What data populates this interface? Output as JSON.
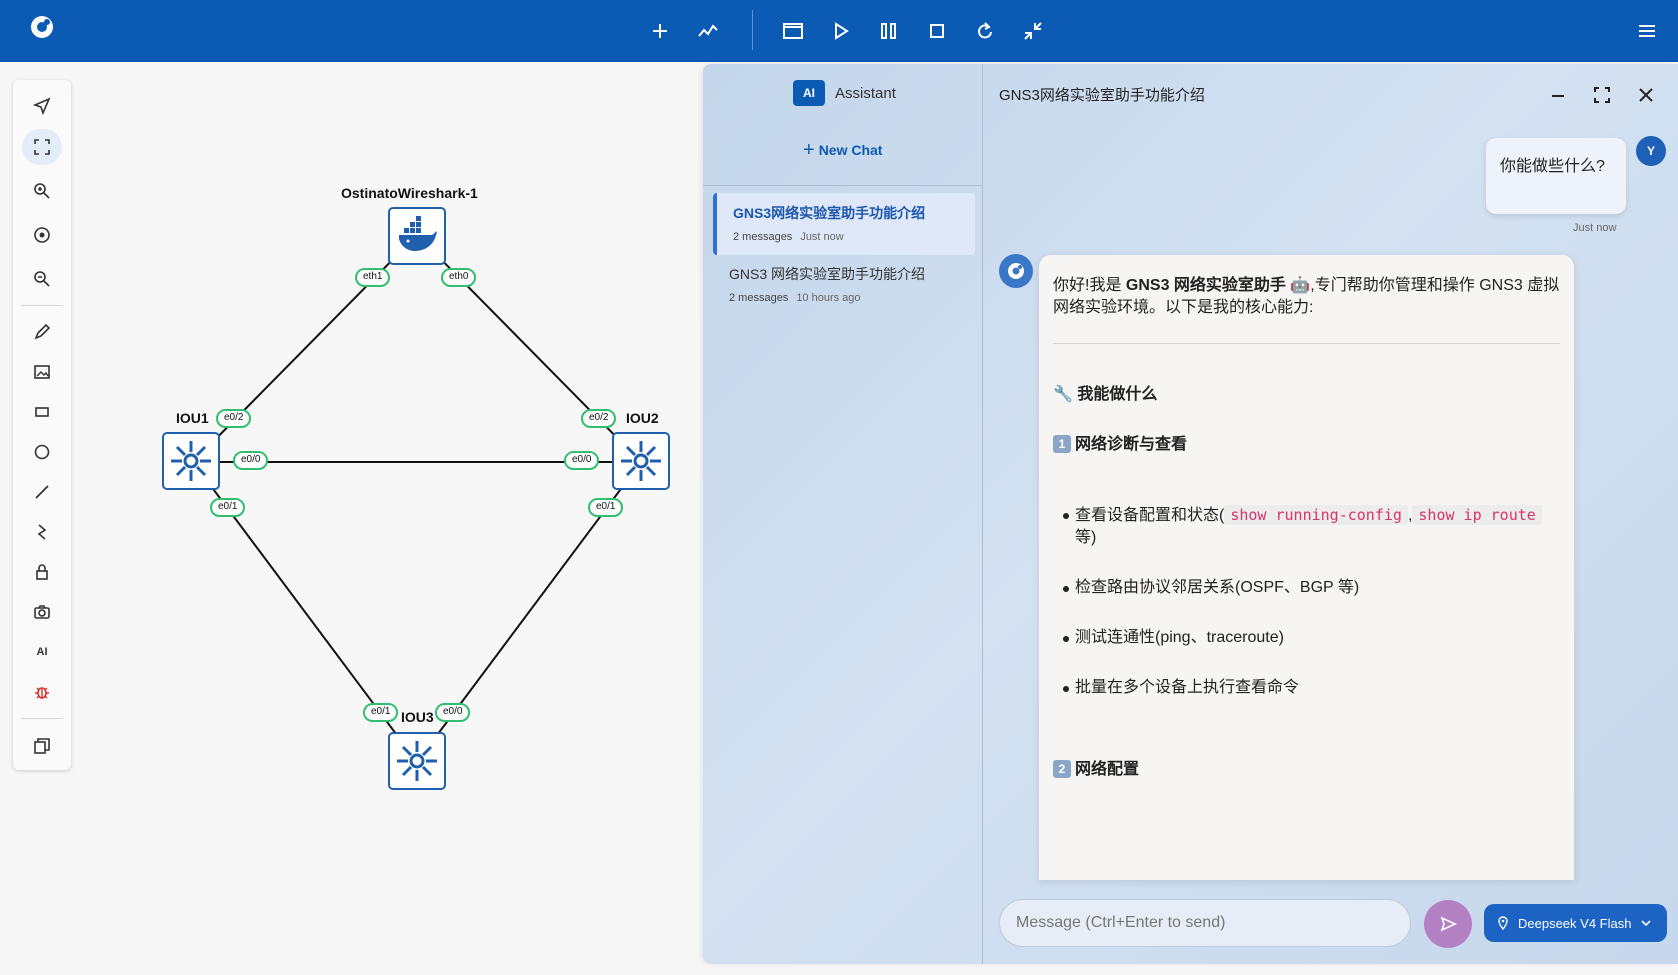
{
  "toolbar": {
    "logo_icon": "gns3-logo-icon",
    "buttons": [
      "add-icon",
      "chart-icon",
      "console-icon",
      "play-icon",
      "pause-icon",
      "stop-icon",
      "reload-icon",
      "collapse-icon",
      "menu-icon"
    ]
  },
  "tool_rail": {
    "tools": [
      "navigate-icon",
      "fit-screen-icon",
      "zoom-in-icon",
      "reset-zoom-icon",
      "zoom-out-icon",
      "pencil-icon",
      "image-icon",
      "rectangle-icon",
      "ellipse-icon",
      "line-icon",
      "curve-icon",
      "lock-icon",
      "camera-icon",
      "ai-icon",
      "bug-icon",
      "layers-icon"
    ],
    "ai_label": "AI"
  },
  "topology": {
    "nodes": {
      "wireshark": "OstinatoWireshark-1",
      "iou1": "IOU1",
      "iou2": "IOU2",
      "iou3": "IOU3"
    },
    "ports": {
      "ws_eth1": "eth1",
      "ws_eth0": "eth0",
      "iou1_e02": "e0/2",
      "iou1_e00": "e0/0",
      "iou1_e01": "e0/1",
      "iou2_e02": "e0/2",
      "iou2_e00": "e0/0",
      "iou2_e01": "e0/1",
      "iou3_e01": "e0/1",
      "iou3_e00": "e0/0"
    }
  },
  "assistant": {
    "ai_badge": "AI",
    "tab_label": "Assistant",
    "new_chat": "New Chat",
    "chats": [
      {
        "title": "GNS3网络实验室助手功能介绍",
        "count": "2 messages",
        "ago": "Just now"
      },
      {
        "title": "GNS3 网络实验室助手功能介绍",
        "count": "2 messages",
        "ago": "10 hours ago"
      }
    ],
    "conversation_title": "GNS3网络实验室助手功能介绍",
    "user_avatar": "Y",
    "user_message": "你能做些什么?",
    "user_time": "Just now",
    "bot": {
      "intro_1": "你好!我是 ",
      "intro_bold": "GNS3 网络实验室助手",
      "intro_2": " 🤖,专门帮助你管理和操作 GNS3 虚拟网络实验环境。以下是我的核心能力:",
      "heading_main": "🔧 我能做什么",
      "section1_num": "1",
      "section1_title": "网络诊断与查看",
      "bullet1_a": "查看设备配置和状态(",
      "bullet1_code1": "show running-config",
      "bullet1_sep": ",",
      "bullet1_code2": "show ip route",
      "bullet1_b": " 等)",
      "bullet2": "检查路由协议邻居关系(OSPF、BGP 等)",
      "bullet3": "测试连通性(ping、traceroute)",
      "bullet4": "批量在多个设备上执行查看命令",
      "section2_num": "2",
      "section2_title": "网络配置"
    },
    "composer_placeholder": "Message (Ctrl+Enter to send)",
    "model": "Deepseek V4 Flash"
  }
}
